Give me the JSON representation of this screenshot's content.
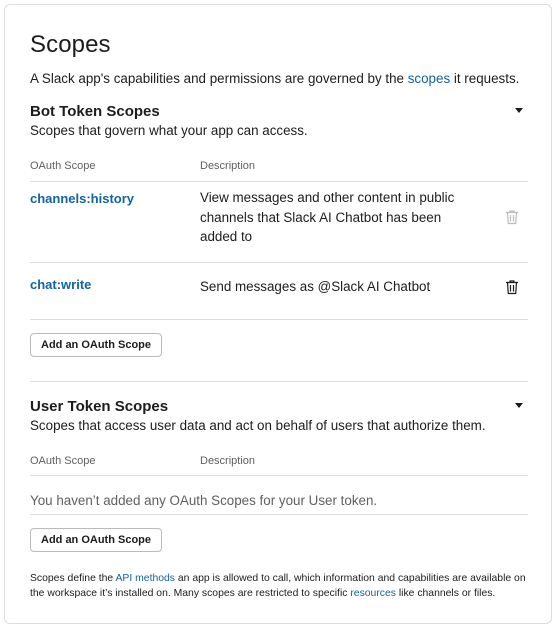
{
  "page": {
    "title": "Scopes",
    "intro_prefix": "A Slack app's capabilities and permissions are governed by the ",
    "intro_link": "scopes",
    "intro_suffix": " it requests."
  },
  "bot": {
    "title": "Bot Token Scopes",
    "subtitle": "Scopes that govern what your app can access.",
    "col_scope": "OAuth Scope",
    "col_desc": "Description",
    "rows": [
      {
        "scope": "channels:history",
        "description": "View messages and other content in public channels that Slack AI Chatbot has been added to",
        "removable": false
      },
      {
        "scope": "chat:write",
        "description": "Send messages as @Slack AI Chatbot",
        "removable": true
      }
    ],
    "add_button": "Add an OAuth Scope"
  },
  "user": {
    "title": "User Token Scopes",
    "subtitle": "Scopes that access user data and act on behalf of users that authorize them.",
    "col_scope": "OAuth Scope",
    "col_desc": "Description",
    "empty_text": "You haven’t added any OAuth Scopes for your User token.",
    "add_button": "Add an OAuth Scope"
  },
  "footer": {
    "p1": "Scopes define the ",
    "link1": "API methods",
    "p2": " an app is allowed to call, which information and capabilities are available on the workspace it’s installed on. Many scopes are restricted to specific ",
    "link2": "resources",
    "p3": " like channels or files."
  },
  "colors": {
    "link": "#1264a3",
    "text": "#1d1c1d",
    "muted": "#616061",
    "border": "#dddddd",
    "icon_disabled": "#bbbbbb"
  },
  "icons": {
    "section_toggle": "caret-down-icon",
    "remove": "trash-icon"
  }
}
